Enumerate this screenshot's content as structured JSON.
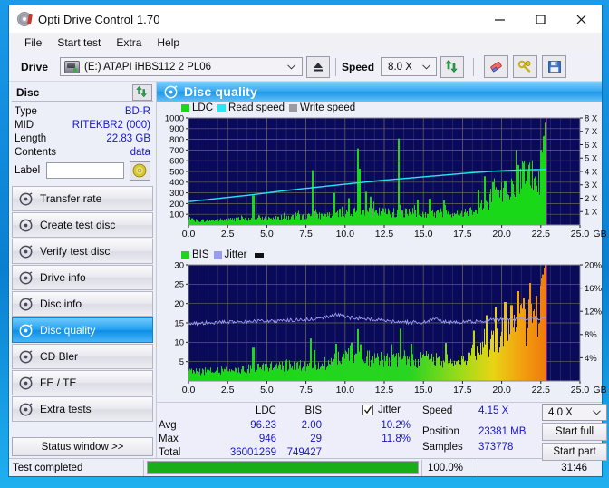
{
  "window": {
    "title": "Opti Drive Control 1.70",
    "icon": "disc-icon",
    "minimize_label": "–",
    "maximize_label": "□",
    "close_label": "✕"
  },
  "menu": {
    "items": [
      "File",
      "Start test",
      "Extra",
      "Help"
    ]
  },
  "toolbar": {
    "drive_label": "Drive",
    "drive_value": "(E:)  ATAPI iHBS112  2 PL06",
    "eject_icon": "eject-icon",
    "speed_label": "Speed",
    "speed_value": "8.0 X",
    "refresh_icon": "refresh-icon",
    "eraser_icon": "eraser-icon",
    "tools_icon": "tools-icon",
    "save_icon": "save-icon"
  },
  "disc_panel": {
    "header": "Disc",
    "refresh_icon": "refresh-icon",
    "rows": [
      {
        "key": "Type",
        "value": "BD-R"
      },
      {
        "key": "MID",
        "value": "RITEKBR2 (000)"
      },
      {
        "key": "Length",
        "value": "22.83 GB"
      },
      {
        "key": "Contents",
        "value": "data"
      }
    ],
    "label_key": "Label",
    "label_value": "",
    "label_placeholder": "",
    "disc_icon": "cd-disc-icon"
  },
  "nav": {
    "items": [
      {
        "label": "Transfer rate",
        "icon": "disc-icon",
        "active": false
      },
      {
        "label": "Create test disc",
        "icon": "disc-icon",
        "active": false
      },
      {
        "label": "Verify test disc",
        "icon": "disc-icon",
        "active": false
      },
      {
        "label": "Drive info",
        "icon": "disc-icon",
        "active": false
      },
      {
        "label": "Disc info",
        "icon": "disc-icon",
        "active": false
      },
      {
        "label": "Disc quality",
        "icon": "disc-icon",
        "active": true
      },
      {
        "label": "CD Bler",
        "icon": "disc-icon",
        "active": false
      },
      {
        "label": "FE / TE",
        "icon": "disc-icon",
        "active": false
      },
      {
        "label": "Extra tests",
        "icon": "disc-icon",
        "active": false
      }
    ],
    "status_window_button": "Status window >>"
  },
  "content": {
    "header_title": "Disc quality",
    "header_icon": "disc-icon"
  },
  "stats": {
    "col_headers": [
      "LDC",
      "BIS"
    ],
    "row_labels": [
      "Avg",
      "Max",
      "Total"
    ],
    "ldc": {
      "avg": "96.23",
      "max": "946",
      "total": "36001269"
    },
    "bis": {
      "avg": "2.00",
      "max": "29",
      "total": "749427"
    },
    "jitter": {
      "checkbox_label": "Jitter",
      "checked": true,
      "avg": "10.2%",
      "max": "11.8%"
    },
    "speed_label": "Speed",
    "speed_value": "4.15 X",
    "position_label": "Position",
    "position_value": "23381 MB",
    "samples_label": "Samples",
    "samples_value": "373778",
    "test_speed_value": "4.0 X",
    "start_full_label": "Start full",
    "start_part_label": "Start part"
  },
  "footer": {
    "status_text": "Test completed",
    "progress_percent": "100.0%",
    "progress_value": 100,
    "elapsed_time": "31:46"
  },
  "colors": {
    "plot_bg": "#0a0a5a",
    "ldc_green": "#18d818",
    "read_speed_cyan": "#25e8f0",
    "write_speed_gray": "#9a9aa0",
    "jitter_blue": "#9a9aee",
    "accent_blue": "#1616c8",
    "progress_green": "#19ae19",
    "title_gradient": "#22a0f0"
  },
  "chart_data": [
    {
      "type": "area",
      "id": "ldc-chart",
      "title": "",
      "xlabel": "GB",
      "ylabel": "",
      "xlim": [
        0.0,
        25.0
      ],
      "xticks": [
        0.0,
        2.5,
        5.0,
        7.5,
        10.0,
        12.5,
        15.0,
        17.5,
        20.0,
        22.5,
        25.0
      ],
      "xticklabels": [
        "0.0",
        "2.5",
        "5.0",
        "7.5",
        "10.0",
        "12.5",
        "15.0",
        "17.5",
        "20.0",
        "22.5",
        "25.0"
      ],
      "ylim": [
        0,
        1000
      ],
      "yticks": [
        100,
        200,
        300,
        400,
        500,
        600,
        700,
        800,
        900,
        1000
      ],
      "yticklabels": [
        "100",
        "200",
        "300",
        "400",
        "500",
        "600",
        "700",
        "800",
        "900",
        "1000"
      ],
      "y2lim": [
        0,
        8
      ],
      "y2ticks": [
        1,
        2,
        3,
        4,
        5,
        6,
        7,
        8
      ],
      "y2ticklabels": [
        "1 X",
        "2 X",
        "3 X",
        "4 X",
        "5 X",
        "6 X",
        "7 X",
        "8 X"
      ],
      "grid": true,
      "legend": [
        {
          "label": "LDC",
          "color": "#18d818"
        },
        {
          "label": "Read speed",
          "color": "#25e8f0"
        },
        {
          "label": "Write speed",
          "color": "#9a9aa0"
        }
      ],
      "series": [
        {
          "name": "LDC",
          "kind": "bars",
          "color": "#18d818",
          "x_end": 22.83,
          "baseline": [
            [
              0.0,
              55
            ],
            [
              0.6,
              45
            ],
            [
              1.2,
              48
            ],
            [
              2.0,
              52
            ],
            [
              2.8,
              58
            ],
            [
              3.6,
              62
            ],
            [
              4.1,
              70
            ],
            [
              5.0,
              72
            ],
            [
              6.0,
              78
            ],
            [
              7.0,
              84
            ],
            [
              7.8,
              92
            ],
            [
              8.6,
              100
            ],
            [
              9.4,
              118
            ],
            [
              10.2,
              128
            ],
            [
              11.0,
              140
            ],
            [
              11.8,
              138
            ],
            [
              12.6,
              132
            ],
            [
              13.4,
              130
            ],
            [
              14.2,
              128
            ],
            [
              15.0,
              126
            ],
            [
              15.8,
              124
            ],
            [
              16.6,
              126
            ],
            [
              17.4,
              130
            ],
            [
              18.0,
              150
            ],
            [
              18.6,
              200
            ],
            [
              19.2,
              250
            ],
            [
              19.8,
              310
            ],
            [
              20.4,
              380
            ],
            [
              20.8,
              440
            ],
            [
              21.2,
              490
            ],
            [
              21.6,
              520
            ],
            [
              22.0,
              505
            ],
            [
              22.2,
              430
            ],
            [
              22.4,
              470
            ],
            [
              22.6,
              640
            ],
            [
              22.78,
              950
            ]
          ],
          "spikes": [
            [
              4.1,
              275
            ],
            [
              7.9,
              512
            ],
            [
              9.3,
              300
            ],
            [
              10.2,
              250
            ],
            [
              10.8,
              715
            ],
            [
              10.9,
              525
            ],
            [
              11.3,
              310
            ],
            [
              11.6,
              265
            ],
            [
              13.4,
              808
            ],
            [
              14.6,
              235
            ],
            [
              15.4,
              245
            ],
            [
              16.3,
              230
            ],
            [
              18.5,
              330
            ],
            [
              18.9,
              455
            ],
            [
              19.4,
              400
            ],
            [
              20.2,
              415
            ],
            [
              21.0,
              560
            ],
            [
              21.4,
              525
            ],
            [
              22.5,
              700
            ],
            [
              22.8,
              955
            ]
          ]
        },
        {
          "name": "Read speed",
          "kind": "line",
          "color": "#25e8f0",
          "points": [
            [
              0.0,
              1.75
            ],
            [
              2.0,
              2.0
            ],
            [
              4.0,
              2.25
            ],
            [
              6.0,
              2.55
            ],
            [
              8.0,
              2.8
            ],
            [
              10.0,
              3.05
            ],
            [
              12.0,
              3.3
            ],
            [
              14.0,
              3.5
            ],
            [
              16.0,
              3.7
            ],
            [
              18.0,
              3.9
            ],
            [
              19.5,
              4.02
            ],
            [
              20.5,
              4.08
            ],
            [
              21.5,
              4.12
            ],
            [
              22.8,
              4.15
            ]
          ]
        }
      ]
    },
    {
      "type": "area",
      "id": "bis-chart",
      "title": "",
      "xlabel": "GB",
      "ylabel": "",
      "xlim": [
        0.0,
        25.0
      ],
      "xticks": [
        0.0,
        2.5,
        5.0,
        7.5,
        10.0,
        12.5,
        15.0,
        17.5,
        20.0,
        22.5,
        25.0
      ],
      "xticklabels": [
        "0.0",
        "2.5",
        "5.0",
        "7.5",
        "10.0",
        "12.5",
        "15.0",
        "17.5",
        "20.0",
        "22.5",
        "25.0"
      ],
      "ylim": [
        0,
        30
      ],
      "yticks": [
        5,
        10,
        15,
        20,
        25,
        30
      ],
      "yticklabels": [
        "5",
        "10",
        "15",
        "20",
        "25",
        "30"
      ],
      "y2lim": [
        0,
        20
      ],
      "y2ticks": [
        4,
        8,
        12,
        16,
        20
      ],
      "y2ticklabels": [
        "4%",
        "8%",
        "12%",
        "16%",
        "20%"
      ],
      "grid": true,
      "legend": [
        {
          "label": "BIS",
          "color": "#18d818"
        },
        {
          "label": "Jitter",
          "color": "#9a9aee"
        }
      ],
      "series": [
        {
          "name": "BIS",
          "kind": "bars",
          "x_end": 22.83,
          "baseline": [
            [
              0.0,
              2.6
            ],
            [
              1.0,
              2.8
            ],
            [
              2.0,
              3.0
            ],
            [
              3.0,
              3.2
            ],
            [
              4.0,
              3.6
            ],
            [
              5.0,
              4.0
            ],
            [
              6.0,
              4.2
            ],
            [
              7.0,
              4.4
            ],
            [
              8.0,
              4.8
            ],
            [
              8.9,
              5.1
            ],
            [
              9.1,
              6.6
            ],
            [
              10.0,
              6.8
            ],
            [
              11.0,
              6.6
            ],
            [
              12.0,
              6.2
            ],
            [
              13.0,
              6.0
            ],
            [
              14.0,
              5.9
            ],
            [
              15.0,
              5.8
            ],
            [
              16.0,
              5.8
            ],
            [
              17.0,
              6.0
            ],
            [
              17.8,
              6.6
            ],
            [
              18.4,
              8.6
            ],
            [
              19.0,
              10.5
            ],
            [
              19.6,
              12.4
            ],
            [
              20.2,
              14.0
            ],
            [
              20.8,
              15.4
            ],
            [
              21.4,
              16.2
            ],
            [
              22.0,
              16.8
            ],
            [
              22.4,
              19.5
            ],
            [
              22.7,
              26.5
            ],
            [
              22.82,
              29.8
            ]
          ],
          "spikes": [
            [
              4.1,
              8.6
            ],
            [
              7.8,
              11.0
            ],
            [
              8.0,
              8.0
            ],
            [
              9.4,
              9.6
            ],
            [
              10.4,
              9.9
            ],
            [
              10.8,
              13.4
            ],
            [
              11.0,
              9.5
            ],
            [
              13.5,
              13.5
            ],
            [
              14.2,
              9.6
            ],
            [
              16.4,
              9.8
            ],
            [
              18.2,
              13.0
            ],
            [
              19.0,
              17.0
            ],
            [
              19.6,
              19.0
            ],
            [
              20.2,
              20.4
            ],
            [
              20.6,
              19.6
            ],
            [
              21.0,
              23.2
            ],
            [
              21.4,
              21.5
            ],
            [
              21.8,
              25.3
            ],
            [
              22.2,
              22.0
            ],
            [
              22.6,
              27.5
            ],
            [
              22.8,
              30.0
            ]
          ],
          "gradient_stops": [
            {
              "pos": 0.0,
              "color": "#18d818"
            },
            {
              "pos": 0.62,
              "color": "#2ad422"
            },
            {
              "pos": 0.76,
              "color": "#9ddb1a"
            },
            {
              "pos": 0.85,
              "color": "#e8d414"
            },
            {
              "pos": 0.93,
              "color": "#f2a010"
            },
            {
              "pos": 1.0,
              "color": "#f07a0a"
            }
          ]
        },
        {
          "name": "Jitter",
          "kind": "line",
          "color": "#9a9aee",
          "points": [
            [
              0.0,
              14.8
            ],
            [
              1.0,
              15.0
            ],
            [
              2.0,
              15.2
            ],
            [
              3.0,
              15.3
            ],
            [
              4.0,
              15.4
            ],
            [
              5.0,
              15.5
            ],
            [
              6.0,
              15.6
            ],
            [
              7.0,
              15.7
            ],
            [
              8.0,
              16.0
            ],
            [
              9.0,
              16.6
            ],
            [
              9.4,
              17.4
            ],
            [
              10.0,
              16.4
            ],
            [
              11.0,
              16.2
            ],
            [
              12.0,
              15.7
            ],
            [
              13.0,
              15.4
            ],
            [
              14.0,
              15.2
            ],
            [
              15.0,
              15.1
            ],
            [
              15.6,
              16.0
            ],
            [
              16.4,
              15.3
            ],
            [
              17.4,
              15.2
            ],
            [
              18.4,
              15.4
            ],
            [
              19.4,
              15.8
            ],
            [
              20.4,
              16.0
            ],
            [
              21.4,
              16.1
            ],
            [
              22.4,
              16.2
            ],
            [
              22.82,
              16.9
            ]
          ]
        }
      ]
    }
  ]
}
